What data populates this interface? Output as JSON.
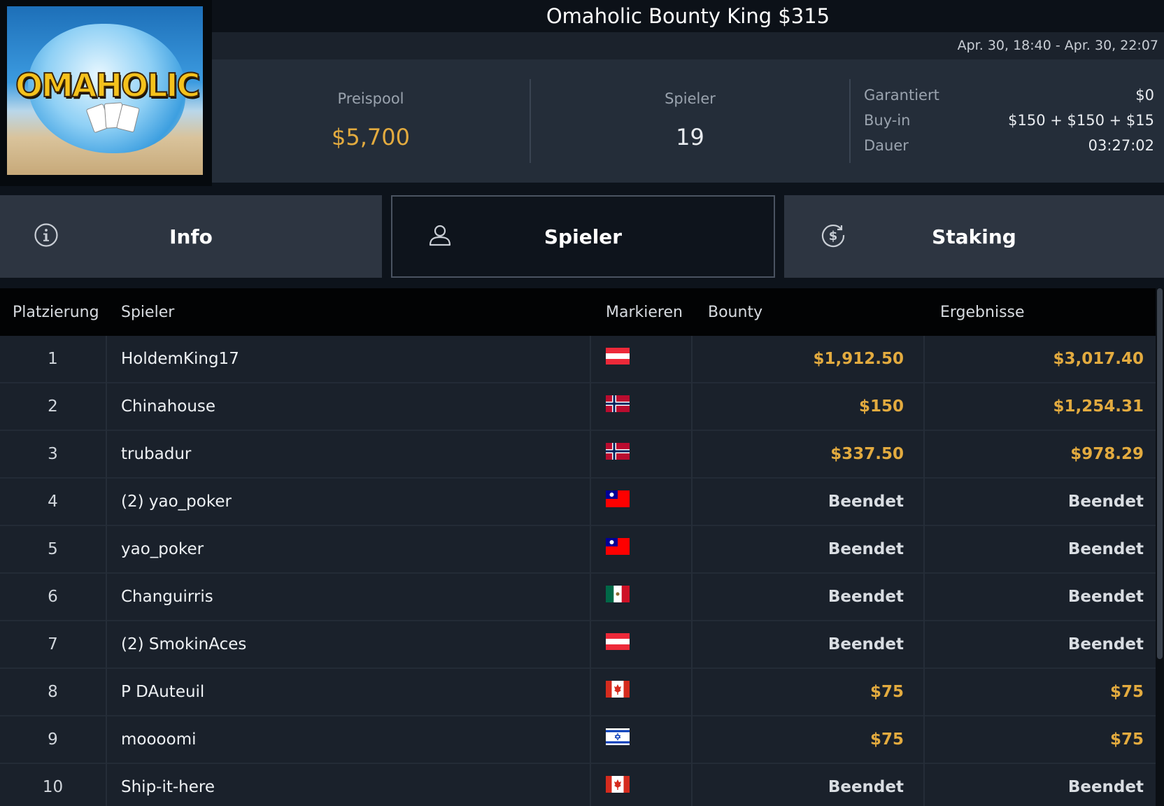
{
  "header": {
    "title": "Omaholic Bounty King $315",
    "date_range": "Apr. 30, 18:40 - Apr. 30, 22:07"
  },
  "logo": {
    "text": "OMAHOLIC"
  },
  "stats": {
    "prizepool_label": "Preispool",
    "prizepool_value": "$5,700",
    "players_label": "Spieler",
    "players_value": "19",
    "details": [
      {
        "label": "Garantiert",
        "value": "$0"
      },
      {
        "label": "Buy-in",
        "value": "$150 + $150 + $15"
      },
      {
        "label": "Dauer",
        "value": "03:27:02"
      }
    ]
  },
  "tabs": [
    {
      "label": "Info",
      "icon": "info-icon",
      "active": false
    },
    {
      "label": "Spieler",
      "icon": "user-icon",
      "active": true
    },
    {
      "label": "Staking",
      "icon": "dollar-circle-icon",
      "active": false
    }
  ],
  "table": {
    "columns": [
      "Platzierung",
      "Spieler",
      "Markieren",
      "Bounty",
      "Ergebnisse"
    ],
    "rows": [
      {
        "place": "1",
        "name": "HoldemKing17",
        "flag": "austria-flag",
        "bounty": "$1,912.50",
        "result": "$3,017.40"
      },
      {
        "place": "2",
        "name": "Chinahouse",
        "flag": "norway-flag",
        "bounty": "$150",
        "result": "$1,254.31"
      },
      {
        "place": "3",
        "name": "trubadur",
        "flag": "norway-flag",
        "bounty": "$337.50",
        "result": "$978.29"
      },
      {
        "place": "4",
        "name": "(2) yao_poker",
        "flag": "taiwan-flag",
        "bounty": "Beendet",
        "result": "Beendet"
      },
      {
        "place": "5",
        "name": "yao_poker",
        "flag": "taiwan-flag",
        "bounty": "Beendet",
        "result": "Beendet"
      },
      {
        "place": "6",
        "name": "Changuirris",
        "flag": "mexico-flag",
        "bounty": "Beendet",
        "result": "Beendet"
      },
      {
        "place": "7",
        "name": "(2) SmokinAces",
        "flag": "austria-flag",
        "bounty": "Beendet",
        "result": "Beendet"
      },
      {
        "place": "8",
        "name": "P DAuteuil",
        "flag": "canada-flag",
        "bounty": "$75",
        "result": "$75"
      },
      {
        "place": "9",
        "name": "moooomi",
        "flag": "israel-flag",
        "bounty": "$75",
        "result": "$75"
      },
      {
        "place": "10",
        "name": "Ship-it-here",
        "flag": "canada-flag",
        "bounty": "Beendet",
        "result": "Beendet"
      }
    ]
  },
  "colors": {
    "gold": "#e3ab3f",
    "muted": "#9aa3ae"
  }
}
